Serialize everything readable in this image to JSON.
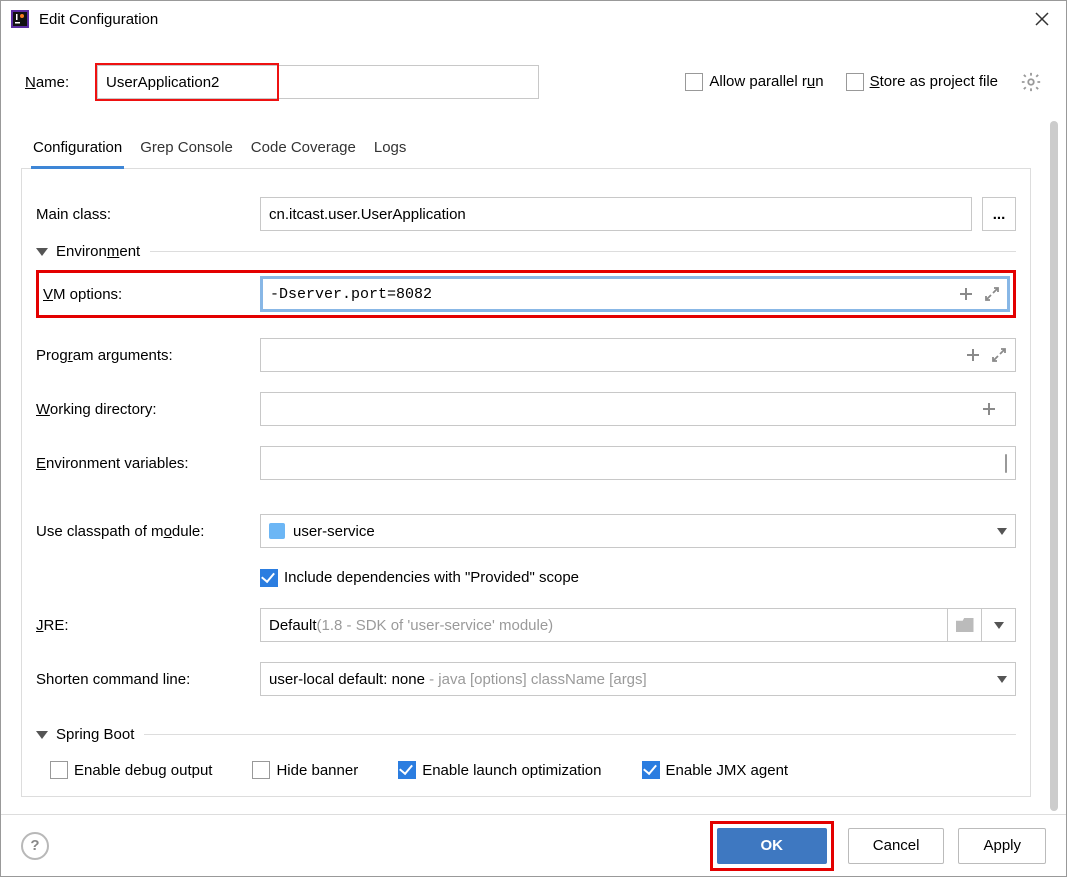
{
  "window": {
    "title": "Edit Configuration"
  },
  "name": {
    "label": "Name:",
    "value": "UserApplication2"
  },
  "top_checks": {
    "allow_parallel": {
      "label": "Allow parallel run",
      "checked": false,
      "accel": "u"
    },
    "store_project": {
      "label": "Store as project file",
      "checked": false,
      "accel": "S"
    }
  },
  "tabs": [
    "Configuration",
    "Grep Console",
    "Code Coverage",
    "Logs"
  ],
  "active_tab": 0,
  "form": {
    "main_class": {
      "label": "Main class:",
      "value": "cn.itcast.user.UserApplication"
    },
    "env_section": "Environment",
    "vm_options": {
      "label": "VM options:",
      "value": "-Dserver.port=8082",
      "accel": "V"
    },
    "program_args": {
      "label": "Program arguments:",
      "value": "",
      "accel": "r"
    },
    "working_dir": {
      "label": "Working directory:",
      "value": "",
      "accel": "W"
    },
    "env_vars": {
      "label": "Environment variables:",
      "value": "",
      "accel": "E"
    },
    "classpath_module": {
      "label": "Use classpath of module:",
      "value": "user-service",
      "accel": "o"
    },
    "include_provided": {
      "label": "Include dependencies with \"Provided\" scope",
      "checked": true
    },
    "jre": {
      "label": "JRE:",
      "prefix": "Default",
      "hint": " (1.8 - SDK of 'user-service' module)",
      "accel": "J"
    },
    "shorten": {
      "label": "Shorten command line:",
      "prefix": "user-local default: none",
      "hint": " - java [options] className [args]"
    },
    "spring_section": "Spring Boot",
    "sb": {
      "debug": {
        "label": "Enable debug output",
        "checked": false
      },
      "hide_banner": {
        "label": "Hide banner",
        "checked": false
      },
      "launch_opt": {
        "label": "Enable launch optimization",
        "checked": true
      },
      "jmx": {
        "label": "Enable JMX agent",
        "checked": true
      }
    }
  },
  "buttons": {
    "ok": "OK",
    "cancel": "Cancel",
    "apply": "Apply"
  }
}
